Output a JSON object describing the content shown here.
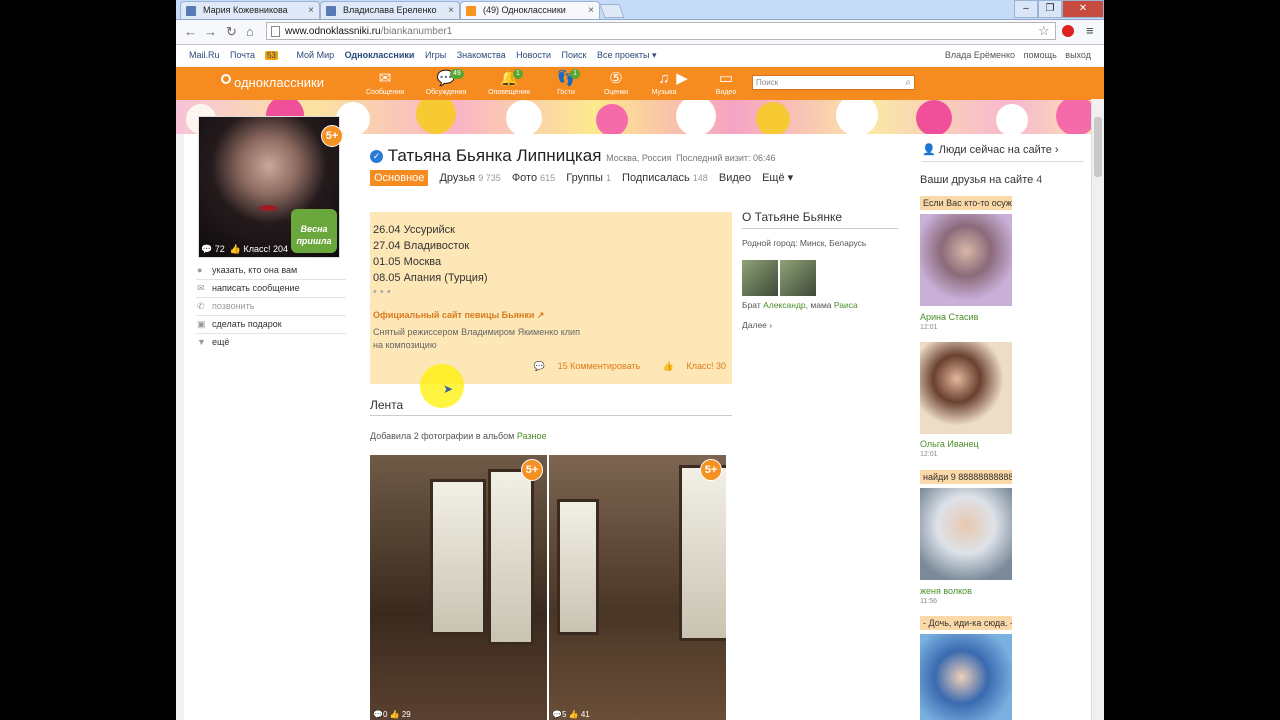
{
  "browser": {
    "tabs": [
      {
        "title": "Мария Кожевникова"
      },
      {
        "title": "Владислава Ереленко"
      },
      {
        "title": "(49) Одноклассники"
      }
    ],
    "url_host": "www.odnoklassniki.ru",
    "url_path": "/biankanumber1"
  },
  "portal": {
    "links": [
      "Mail.Ru",
      "Почта",
      "Мой Мир",
      "Одноклассники",
      "Игры",
      "Знакомства",
      "Новости",
      "Поиск",
      "Все проекты ▾"
    ],
    "mail_badge": "53",
    "user": "Влада Ерёменко",
    "help": "помощь",
    "logout": "выход"
  },
  "ok": {
    "logo": "одноклассники",
    "nav": [
      {
        "label": "Сообщения",
        "icon": "envelope-icon",
        "count": ""
      },
      {
        "label": "Обсуждения",
        "icon": "chat-icon",
        "count": "49"
      },
      {
        "label": "Оповещения",
        "icon": "bell-icon",
        "count": "1"
      },
      {
        "label": "Гости",
        "icon": "footprints-icon",
        "count": "1"
      },
      {
        "label": "Оценки",
        "icon": "rating-icon",
        "count": ""
      },
      {
        "label": "Музыка",
        "icon": "music-icon",
        "count": ""
      },
      {
        "label": "Видео",
        "icon": "video-icon",
        "count": ""
      }
    ],
    "search_placeholder": "Поиск"
  },
  "profile": {
    "name": "Татьяна Бьянка Липницкая",
    "location": "Москва, Россия",
    "last_visit": "Последний визит: 06:46",
    "age_badge": "5+",
    "avatar_comments": "72",
    "avatar_class": "Класс! 204",
    "spring_text": "Весна пришла",
    "actions": [
      "указать, кто она вам",
      "написать сообщение",
      "позвонить",
      "сделать подарок",
      "ещё"
    ],
    "tabs": [
      {
        "label": "Основное",
        "count": ""
      },
      {
        "label": "Друзья",
        "count": "9 735"
      },
      {
        "label": "Фото",
        "count": "615"
      },
      {
        "label": "Группы",
        "count": "1"
      },
      {
        "label": "Подписалась",
        "count": "148"
      },
      {
        "label": "Видео",
        "count": ""
      },
      {
        "label": "Ещё ▾",
        "count": ""
      }
    ]
  },
  "status": {
    "lines": [
      "26.04 Уссурийск",
      "27.04 Владивосток",
      "01.05 Москва",
      "08.05 Апания (Турция)"
    ],
    "official": "Официальный сайт певицы Бьянки",
    "desc": "Снятый режиссером Владимиром Якименко клип на композицию",
    "comments": "15 Комментировать",
    "klass": "Класс! 30"
  },
  "about": {
    "title": "О Татьяне Бьянке",
    "hometown": "Родной город: Минск, Беларусь",
    "relatives_prefix": "Брат",
    "brother": "Александр",
    "relatives_middle": ", мама",
    "mother": "Раиса",
    "more": "Далее ›"
  },
  "feed": {
    "title": "Лента",
    "added_prefix": "Добавила 2 фотографии в альбом",
    "album": "Разное",
    "photos": [
      {
        "comments": "0",
        "likes": "29"
      },
      {
        "comments": "5",
        "likes": "41"
      }
    ]
  },
  "right": {
    "people_online": "Люди сейчас на сайте ›",
    "friends_label": "Ваши друзья на сайте",
    "friends_count": "4",
    "friends": [
      {
        "caption": "Если Вас кто-то осуж",
        "name": "Арина Стасив",
        "time": "12:01"
      },
      {
        "caption": "",
        "name": "Ольга Иванец",
        "time": "12:01"
      },
      {
        "caption": "найди 9 88888888888",
        "name": "женя волков",
        "time": "11:56"
      },
      {
        "caption": "- Дочь, иди-ка сюда. -",
        "name": "",
        "time": ""
      }
    ]
  },
  "colors": {
    "brand": "#f68b1f",
    "link_green": "#4a8f2a",
    "status_bg": "#fde7b6"
  }
}
